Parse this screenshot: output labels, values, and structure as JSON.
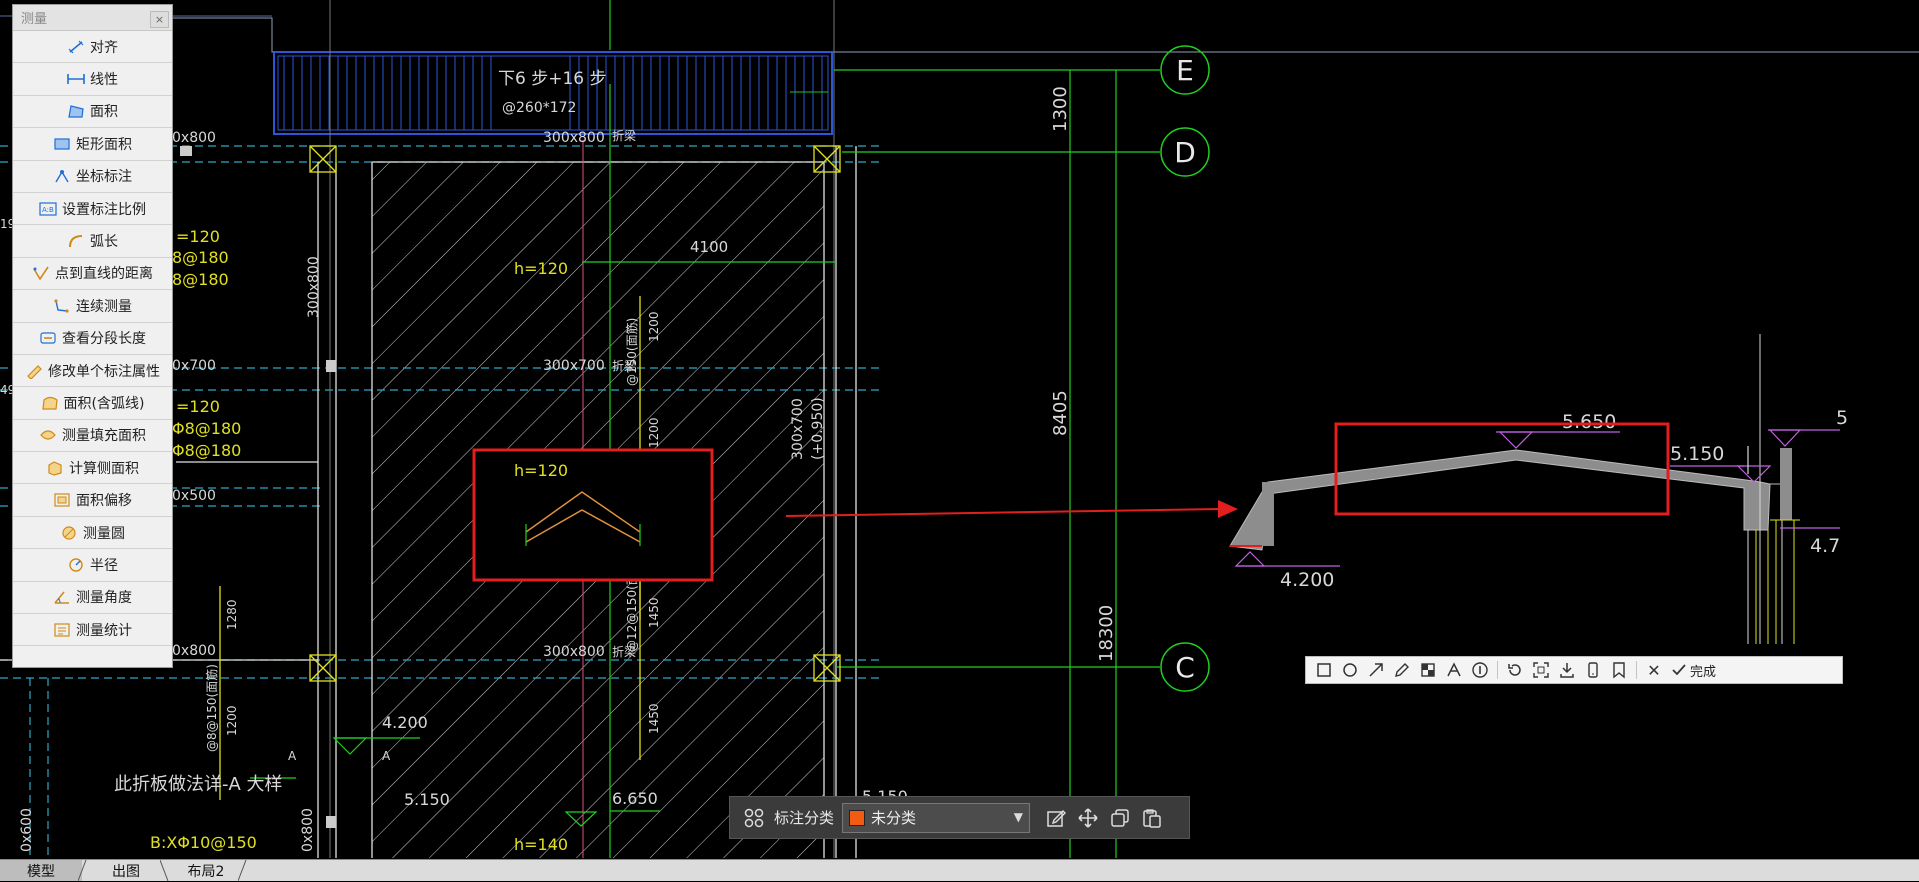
{
  "panel": {
    "title": "测量",
    "close_glyph": "×",
    "tools": [
      {
        "label": "对齐",
        "icon": "align-dim-icon"
      },
      {
        "label": "线性",
        "icon": "linear-dim-icon"
      },
      {
        "label": "面积",
        "icon": "area-icon"
      },
      {
        "label": "矩形面积",
        "icon": "rect-area-icon"
      },
      {
        "label": "坐标标注",
        "icon": "coordinate-icon"
      },
      {
        "label": "设置标注比例",
        "icon": "scale-icon"
      },
      {
        "label": "弧长",
        "icon": "arc-length-icon"
      },
      {
        "label": "点到直线的距离",
        "icon": "point-line-icon"
      },
      {
        "label": "连续测量",
        "icon": "continuous-icon"
      },
      {
        "label": "查看分段长度",
        "icon": "segment-icon"
      },
      {
        "label": "修改单个标注属性",
        "icon": "edit-dim-icon"
      },
      {
        "label": "面积(含弧线)",
        "icon": "arc-area-icon"
      },
      {
        "label": "测量填充面积",
        "icon": "fill-area-icon"
      },
      {
        "label": "计算侧面积",
        "icon": "side-area-icon"
      },
      {
        "label": "面积偏移",
        "icon": "area-offset-icon"
      },
      {
        "label": "测量圆",
        "icon": "circle-measure-icon"
      },
      {
        "label": "半径",
        "icon": "radius-icon"
      },
      {
        "label": "测量角度",
        "icon": "angle-icon"
      },
      {
        "label": "测量统计",
        "icon": "statistics-icon"
      }
    ]
  },
  "drawing": {
    "axis_labels": [
      "E",
      "D",
      "C"
    ],
    "stair_text": {
      "line1": "下6 步+16 步",
      "line2": "@260*172"
    },
    "beam_labels": [
      "300x800",
      "300x700",
      "300x800",
      "300x800",
      "0x800",
      "0x700",
      "0x500",
      "0x800",
      "0x600",
      "0x800"
    ],
    "slab_labels": [
      "h=120",
      "h=120",
      "h=140"
    ],
    "dims": {
      "top": "4100",
      "v1": "1300",
      "v2": "8405",
      "v3": "18300",
      "right_beam": "300x700",
      "right_beam_sub": "(+0.950)"
    },
    "left_texts": [
      "=120",
      "8@180",
      "8@180",
      "=120",
      "Φ8@180",
      "Φ8@180"
    ],
    "rebar_texts": [
      "@150(面筋)",
      "1200",
      "1200",
      "@12@150(面筋)",
      "1450",
      "1450",
      "@8@150(面筋)",
      "1280",
      "1200"
    ],
    "beam_side_labels": [
      "折梁",
      "折梁",
      "折梁"
    ],
    "left_vertical_beam": "300x800",
    "note": "此折板做法详-A  大样",
    "section_mark": "A",
    "bottom_rebar": "B:XΦ10@150",
    "elevations": [
      "4.200",
      "5.150",
      "6.650",
      "5.150"
    ],
    "left_edge_nums": [
      "19",
      "49"
    ],
    "detail": {
      "elevations": [
        "5.650",
        "5.150",
        "4.200",
        "5",
        "4.7"
      ]
    }
  },
  "screenshot_toolbar": {
    "tools": [
      "rectangle-icon",
      "ellipse-icon",
      "arrow-icon",
      "pencil-icon",
      "mosaic-icon",
      "text-icon",
      "number-icon",
      "undo-icon",
      "pin-icon",
      "download-icon",
      "phone-icon",
      "bookmark-icon"
    ],
    "cancel_glyph": "✕",
    "done_label": "完成"
  },
  "annotation_toolbar": {
    "label": "标注分类",
    "category_value": "未分类",
    "category_color": "#f35b12"
  },
  "tabs": [
    {
      "label": "模型",
      "active": true
    },
    {
      "label": "出图",
      "active": false
    },
    {
      "label": "布局2",
      "active": false
    }
  ]
}
